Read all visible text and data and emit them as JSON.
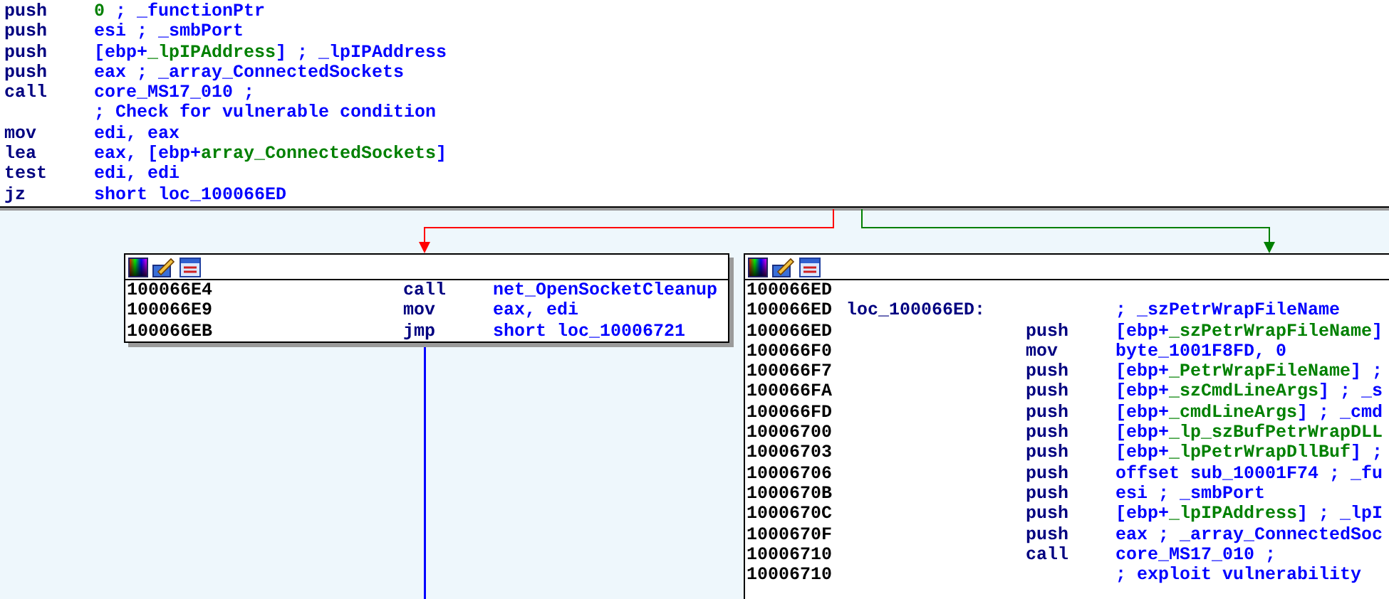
{
  "top_block": {
    "lines": [
      {
        "mnemonic": "push",
        "operand": [
          {
            "text": "0",
            "kind": "var"
          },
          {
            "text": " ; _functionPtr",
            "kind": "plain"
          }
        ]
      },
      {
        "mnemonic": "push",
        "operand": [
          {
            "text": "esi ; _smbPort",
            "kind": "plain"
          }
        ]
      },
      {
        "mnemonic": "push",
        "operand": [
          {
            "text": "[ebp+",
            "kind": "plain"
          },
          {
            "text": "_lpIPAddress",
            "kind": "var"
          },
          {
            "text": "] ; _lpIPAddress",
            "kind": "plain"
          }
        ]
      },
      {
        "mnemonic": "push",
        "operand": [
          {
            "text": "eax ; _array_ConnectedSockets",
            "kind": "plain"
          }
        ]
      },
      {
        "mnemonic": "call",
        "operand": [
          {
            "text": "core_MS17_010 ;",
            "kind": "plain"
          }
        ]
      },
      {
        "operand": [
          {
            "text": "; Check for vulnerable condition",
            "kind": "plain"
          }
        ]
      },
      {
        "mnemonic": "mov",
        "operand": [
          {
            "text": "edi, eax",
            "kind": "plain"
          }
        ]
      },
      {
        "mnemonic": "lea",
        "operand": [
          {
            "text": "eax, [ebp+",
            "kind": "plain"
          },
          {
            "text": "array_ConnectedSockets",
            "kind": "var"
          },
          {
            "text": "]",
            "kind": "plain"
          }
        ]
      },
      {
        "mnemonic": "test",
        "operand": [
          {
            "text": "edi, edi",
            "kind": "plain"
          }
        ]
      },
      {
        "mnemonic": "jz",
        "operand": [
          {
            "text": "short loc_100066ED",
            "kind": "plain"
          }
        ]
      }
    ]
  },
  "edges": [
    {
      "color": "#ff0000"
    },
    {
      "color": "#008000"
    },
    {
      "color": "#0000ff"
    }
  ],
  "nodes": [
    {
      "lines": [
        {
          "address": "100066E4",
          "mnemonic": "call",
          "operand": [
            {
              "text": "net_OpenSocketCleanup",
              "kind": "plain"
            }
          ]
        },
        {
          "address": "100066E9",
          "mnemonic": "mov",
          "operand": [
            {
              "text": "eax, edi",
              "kind": "plain"
            }
          ]
        },
        {
          "address": "100066EB",
          "mnemonic": "jmp",
          "operand": [
            {
              "text": "short loc_10006721",
              "kind": "plain"
            }
          ]
        }
      ]
    },
    {
      "lines": [
        {
          "address": "100066ED"
        },
        {
          "address": "100066ED",
          "label": "loc_100066ED:",
          "operand": [
            {
              "text": "; _szPetrWrapFileName",
              "kind": "plain"
            }
          ]
        },
        {
          "address": "100066ED",
          "mnemonic": "push",
          "operand": [
            {
              "text": "[ebp+",
              "kind": "plain"
            },
            {
              "text": "_szPetrWrapFileName",
              "kind": "var"
            },
            {
              "text": "]",
              "kind": "plain"
            }
          ]
        },
        {
          "address": "100066F0",
          "mnemonic": "mov",
          "operand": [
            {
              "text": "byte_1001F8FD, 0",
              "kind": "plain"
            }
          ]
        },
        {
          "address": "100066F7",
          "mnemonic": "push",
          "operand": [
            {
              "text": "[ebp+",
              "kind": "plain"
            },
            {
              "text": "_PetrWrapFileName",
              "kind": "var"
            },
            {
              "text": "] ;",
              "kind": "plain"
            }
          ]
        },
        {
          "address": "100066FA",
          "mnemonic": "push",
          "operand": [
            {
              "text": "[ebp+",
              "kind": "plain"
            },
            {
              "text": "_szCmdLineArgs",
              "kind": "var"
            },
            {
              "text": "] ; _s",
              "kind": "plain"
            }
          ]
        },
        {
          "address": "100066FD",
          "mnemonic": "push",
          "operand": [
            {
              "text": "[ebp+",
              "kind": "plain"
            },
            {
              "text": "_cmdLineArgs",
              "kind": "var"
            },
            {
              "text": "] ; _cmd",
              "kind": "plain"
            }
          ]
        },
        {
          "address": "10006700",
          "mnemonic": "push",
          "operand": [
            {
              "text": "[ebp+",
              "kind": "plain"
            },
            {
              "text": "_lp_szBufPetrWrapDLL",
              "kind": "var"
            }
          ]
        },
        {
          "address": "10006703",
          "mnemonic": "push",
          "operand": [
            {
              "text": "[ebp+",
              "kind": "plain"
            },
            {
              "text": "_lpPetrWrapDllBuf",
              "kind": "var"
            },
            {
              "text": "] ;",
              "kind": "plain"
            }
          ]
        },
        {
          "address": "10006706",
          "mnemonic": "push",
          "operand": [
            {
              "text": "offset sub_10001F74 ; _fu",
              "kind": "plain"
            }
          ]
        },
        {
          "address": "1000670B",
          "mnemonic": "push",
          "operand": [
            {
              "text": "esi ; _smbPort",
              "kind": "plain"
            }
          ]
        },
        {
          "address": "1000670C",
          "mnemonic": "push",
          "operand": [
            {
              "text": "[ebp+",
              "kind": "plain"
            },
            {
              "text": "_lpIPAddress",
              "kind": "var"
            },
            {
              "text": "] ; _lpI",
              "kind": "plain"
            }
          ]
        },
        {
          "address": "1000670F",
          "mnemonic": "push",
          "operand": [
            {
              "text": "eax ; _array_ConnectedSoc",
              "kind": "plain"
            }
          ]
        },
        {
          "address": "10006710",
          "mnemonic": "call",
          "operand": [
            {
              "text": "core_MS17_010 ;",
              "kind": "plain"
            }
          ]
        },
        {
          "address": "10006710",
          "operand": [
            {
              "text": "; exploit vulnerability",
              "kind": "plain"
            }
          ]
        }
      ]
    }
  ]
}
